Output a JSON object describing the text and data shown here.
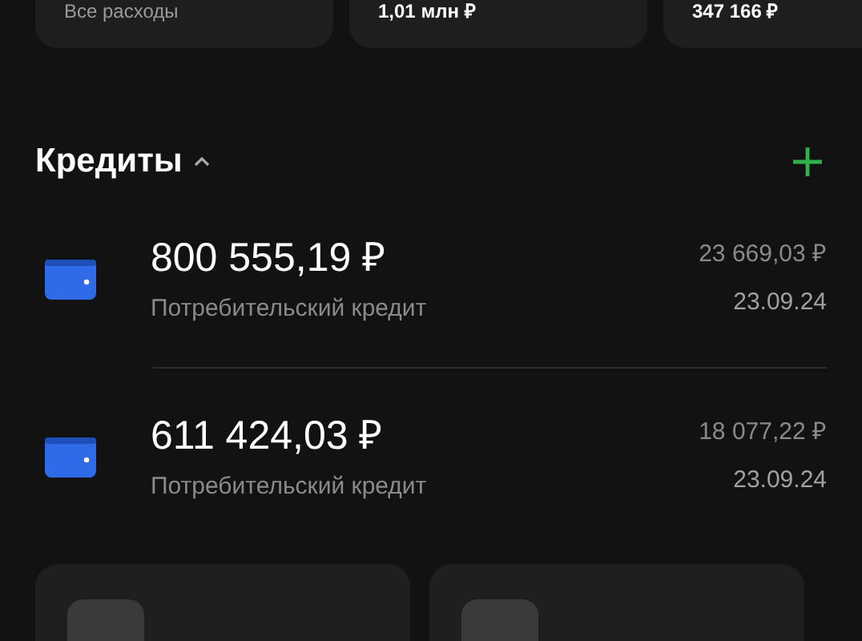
{
  "summary_cards": [
    {
      "text": "Все расходы"
    },
    {
      "text": "1,01 млн ₽"
    },
    {
      "text": "347 166 ₽"
    }
  ],
  "credits": {
    "title": "Кредиты",
    "expanded": true,
    "items": [
      {
        "amount": "800 555,19 ₽",
        "type": "Потребительский кредит",
        "payment": "23 669,03 ₽",
        "date": "23.09.24"
      },
      {
        "amount": "611 424,03 ₽",
        "type": "Потребительский кредит",
        "payment": "18 077,22 ₽",
        "date": "23.09.24"
      }
    ]
  }
}
